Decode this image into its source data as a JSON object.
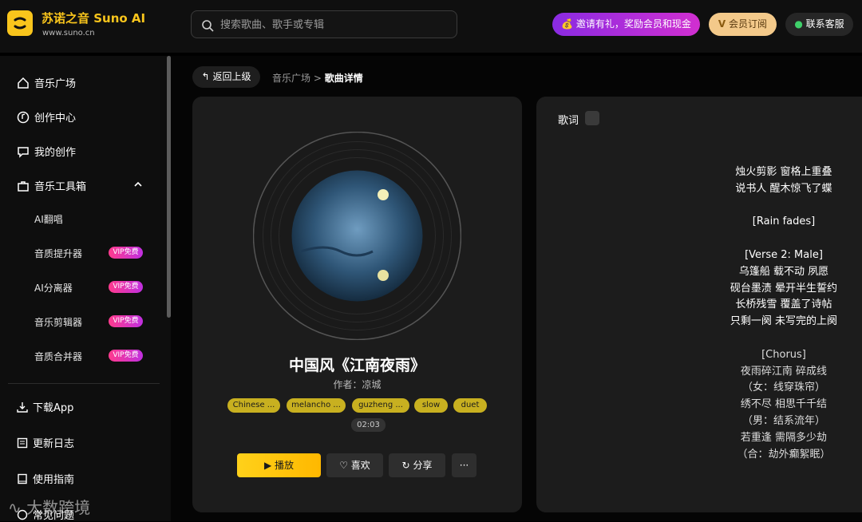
{
  "brand": {
    "name": "苏诺之音 Suno AI",
    "url": "www.suno.cn"
  },
  "search": {
    "placeholder": "搜索歌曲、歌手或专辑"
  },
  "header": {
    "invite": "邀请有礼，奖励会员和现金",
    "vip": "会员订阅",
    "service": "联系客服"
  },
  "sidebar": {
    "items": [
      {
        "label": "音乐广场",
        "icon": "home-icon"
      },
      {
        "label": "创作中心",
        "icon": "music-note-icon"
      },
      {
        "label": "我的创作",
        "icon": "chat-heart-icon"
      },
      {
        "label": "音乐工具箱",
        "icon": "toolbox-icon"
      }
    ],
    "tools": [
      {
        "label": "AI翻唱",
        "badge": ""
      },
      {
        "label": "音质提升器",
        "badge": "VIP免费"
      },
      {
        "label": "AI分离器",
        "badge": "VIP免费"
      },
      {
        "label": "音乐剪辑器",
        "badge": "VIP免费"
      },
      {
        "label": "音质合并器",
        "badge": "VIP免费"
      }
    ],
    "bottom": [
      {
        "label": "下载App",
        "icon": "download-icon"
      },
      {
        "label": "更新日志",
        "icon": "log-icon"
      },
      {
        "label": "使用指南",
        "icon": "book-icon"
      },
      {
        "label": "常见问题",
        "icon": "question-icon"
      }
    ]
  },
  "breadcrumb": {
    "back": "返回上级",
    "parent": "音乐广场",
    "sep": ">",
    "current": "歌曲详情"
  },
  "song": {
    "title": "中国风《江南夜雨》",
    "author": "作者：凉城",
    "tags": [
      "Chinese ...",
      "melancho ...",
      "guzheng ...",
      "slow",
      "duet"
    ],
    "duration": "02:03",
    "play": "播放",
    "like": "喜欢",
    "share": "分享",
    "more": "···"
  },
  "lyrics": {
    "header": "歌词",
    "lines": [
      "烛火剪影 窗格上重叠",
      "说书人 醒木惊飞了蝶",
      "",
      "[Rain fades]",
      "",
      "[Verse 2: Male]",
      "乌篷船 载不动 夙愿",
      "砚台墨渍 晕开半生誓约",
      "长桥残雪 覆盖了诗帖",
      "只剩一阕 未写完的上阕",
      "",
      "[Chorus]",
      "夜雨碎江南 碎成线",
      "（女：线穿珠帘）",
      "绣不尽 相思千千结",
      "（男：结系流年）",
      "若重逢 需隔多少劫",
      "（合：劫外癫絮眠）"
    ]
  },
  "watermark": "大数跨境"
}
